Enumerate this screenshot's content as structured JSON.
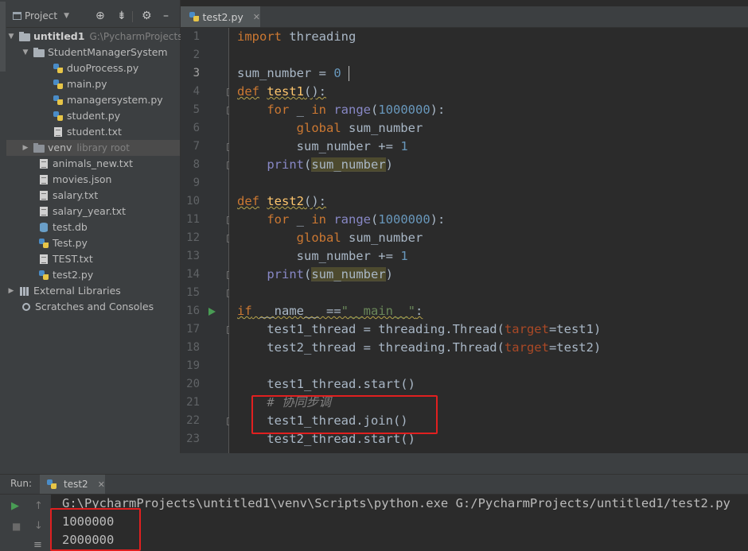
{
  "project_panel": {
    "title": "Project",
    "toolbar_icons": [
      "target-icon",
      "collapse-icon",
      "gear-icon",
      "minimize-icon"
    ],
    "tree": [
      {
        "label": "untitled1",
        "extra": "G:\\PycharmProjects\\",
        "icon": "folder-icon",
        "expanded": true
      },
      {
        "label": "StudentManagerSystem",
        "icon": "folder-icon",
        "expanded": true
      },
      {
        "label": "duoProcess.py",
        "icon": "python-file-icon"
      },
      {
        "label": "main.py",
        "icon": "python-file-icon"
      },
      {
        "label": "managersystem.py",
        "icon": "python-file-icon"
      },
      {
        "label": "student.py",
        "icon": "python-file-icon"
      },
      {
        "label": "student.txt",
        "icon": "text-file-icon"
      },
      {
        "label": "venv",
        "extra": "library root",
        "icon": "folder-icon",
        "expanded": false
      },
      {
        "label": "animals_new.txt",
        "icon": "text-file-icon"
      },
      {
        "label": "movies.json",
        "icon": "text-file-icon"
      },
      {
        "label": "salary.txt",
        "icon": "text-file-icon"
      },
      {
        "label": "salary_year.txt",
        "icon": "text-file-icon"
      },
      {
        "label": "test.db",
        "icon": "database-icon"
      },
      {
        "label": "Test.py",
        "icon": "python-file-icon"
      },
      {
        "label": "TEST.txt",
        "icon": "text-file-icon"
      },
      {
        "label": "test2.py",
        "icon": "python-file-icon"
      },
      {
        "label": "External Libraries",
        "icon": "library-icon",
        "expanded": false
      },
      {
        "label": "Scratches and Consoles",
        "icon": "scratch-icon"
      }
    ]
  },
  "editor": {
    "tab_label": "test2.py",
    "line_numbers": [
      "1",
      "2",
      "3",
      "4",
      "5",
      "6",
      "7",
      "8",
      "9",
      "10",
      "11",
      "12",
      "13",
      "14",
      "15",
      "16",
      "17",
      "18",
      "19",
      "20",
      "21",
      "22",
      "23"
    ],
    "code": {
      "l1_kw": "import",
      "l1_rest": " threading",
      "l3": "sum_number = ",
      "l3_num": "0",
      "l4_kw": "def",
      "l4_fn": "test1",
      "l4_rest": "():",
      "l5_kw1": "for",
      "l5_mid": " _ ",
      "l5_kw2": "in",
      "l5_bi": " range",
      "l5_p": "(",
      "l5_num": "1000000",
      "l5_end": "):",
      "l6_kw": "global",
      "l6_rest": " sum_number",
      "l7_a": "sum_number += ",
      "l7_num": "1",
      "l8_bi": "print",
      "l8_p1": "(",
      "l8_hl": "sum_number",
      "l8_p2": ")",
      "l10_kw": "def",
      "l10_fn": "test2",
      "l10_rest": "():",
      "l11_kw1": "for",
      "l11_mid": " _ ",
      "l11_kw2": "in",
      "l11_bi": " range",
      "l11_p": "(",
      "l11_num": "1000000",
      "l11_end": "):",
      "l12_kw": "global",
      "l12_rest": " sum_number",
      "l13_a": "sum_number += ",
      "l13_num": "1",
      "l14_bi": "print",
      "l14_p1": "(",
      "l14_hl": "sum_number",
      "l14_p2": ")",
      "l16_kw": "if",
      "l16_a": " __name__ ==",
      "l16_str": "\"__main__\"",
      "l16_end": ":",
      "l17_a": "test1_thread = threading.Thread(",
      "l17_param": "target",
      "l17_b": "=test1)",
      "l18_a": "test2_thread = threading.Thread(",
      "l18_param": "target",
      "l18_b": "=test2)",
      "l20": "test1_thread.start()",
      "l21_cmt": "# 协同步调",
      "l22": "test1_thread.join()",
      "l23": "test2_thread.start()"
    }
  },
  "run_panel": {
    "label": "Run:",
    "tab_label": "test2",
    "console_lines": [
      "G:\\PycharmProjects\\untitled1\\venv\\Scripts\\python.exe G:/PycharmProjects/untitled1/test2.py",
      "1000000",
      "2000000"
    ]
  },
  "colors": {
    "keyword": "#cc7832",
    "number": "#6897bb",
    "function": "#ffc66d",
    "builtin": "#8888c6",
    "string": "#6a8759",
    "param": "#aa4926",
    "annotation_box": "#e02020",
    "run_arrow": "#499c54"
  }
}
